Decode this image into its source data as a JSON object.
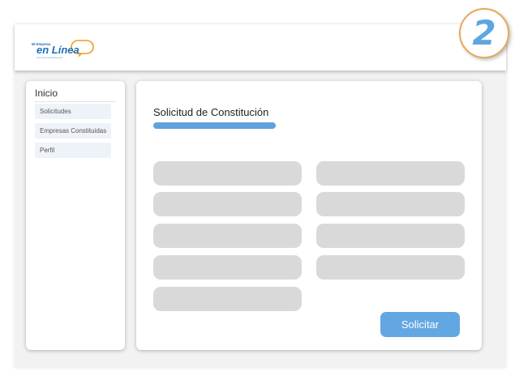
{
  "header": {
    "logo": {
      "small_text": "Mi Empresa",
      "main_text": "en Línea",
      "url_text": "www.miempresaenlinea.gob",
      "colors": {
        "blue": "#1f6fb8",
        "orange": "#f29b1f",
        "light_blue": "#5fa3dc"
      }
    },
    "step_number": "2"
  },
  "sidebar": {
    "title": "Inicio",
    "items": [
      {
        "label": "Solicitudes"
      },
      {
        "label": "Empresas Constituidas"
      },
      {
        "label": "Perfil"
      }
    ]
  },
  "main": {
    "title": "Solicitud de Constitución",
    "accent_color": "#5fa3dc",
    "fields": {
      "left_count": 5,
      "right_count": 4,
      "color": "#d9d9d9"
    },
    "submit_label": "Solicitar"
  }
}
